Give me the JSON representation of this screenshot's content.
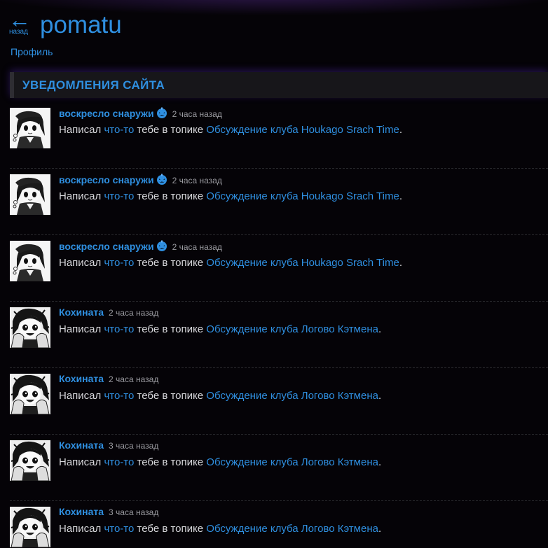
{
  "header": {
    "back_label": "назад",
    "back_icon": "←",
    "username": "pomatu",
    "profile_link": "Профиль"
  },
  "section": {
    "title": "УВЕДОМЛЕНИЯ САЙТА"
  },
  "notifications": [
    {
      "author": "воскресло снаружи",
      "author_icon": "pumpkin-icon",
      "time": "2 часа назад",
      "text_before": "Написал",
      "link_something": "что-то",
      "text_middle": "тебе в топике",
      "topic": "Обсуждение клуба Houkago Srach Time",
      "text_end": "."
    },
    {
      "author": "воскресло снаружи",
      "author_icon": "pumpkin-icon",
      "time": "2 часа назад",
      "text_before": "Написал",
      "link_something": "что-то",
      "text_middle": "тебе в топике",
      "topic": "Обсуждение клуба Houkago Srach Time",
      "text_end": "."
    },
    {
      "author": "воскресло снаружи",
      "author_icon": "pumpkin-icon",
      "time": "2 часа назад",
      "text_before": "Написал",
      "link_something": "что-то",
      "text_middle": "тебе в топике",
      "topic": "Обсуждение клуба Houkago Srach Time",
      "text_end": "."
    },
    {
      "author": "Кохината",
      "time": "2 часа назад",
      "text_before": "Написал",
      "link_something": "что-то",
      "text_middle": "тебе в топике",
      "topic": "Обсуждение клуба Логово Кэтмена",
      "text_end": "."
    },
    {
      "author": "Кохината",
      "time": "2 часа назад",
      "text_before": "Написал",
      "link_something": "что-то",
      "text_middle": "тебе в топике",
      "topic": "Обсуждение клуба Логово Кэтмена",
      "text_end": "."
    },
    {
      "author": "Кохината",
      "time": "3 часа назад",
      "text_before": "Написал",
      "link_something": "что-то",
      "text_middle": "тебе в топике",
      "topic": "Обсуждение клуба Логово Кэтмена",
      "text_end": "."
    },
    {
      "author": "Кохината",
      "time": "3 часа назад",
      "text_before": "Написал",
      "link_something": "что-то",
      "text_middle": "тебе в топике",
      "topic": "Обсуждение клуба Логово Кэтмена",
      "text_end": "."
    }
  ],
  "colors": {
    "background": "#050307",
    "accent": "#2f8fe0",
    "text": "#d8d8dc",
    "muted": "#9a9aa0",
    "section_bg": "#17161a"
  }
}
